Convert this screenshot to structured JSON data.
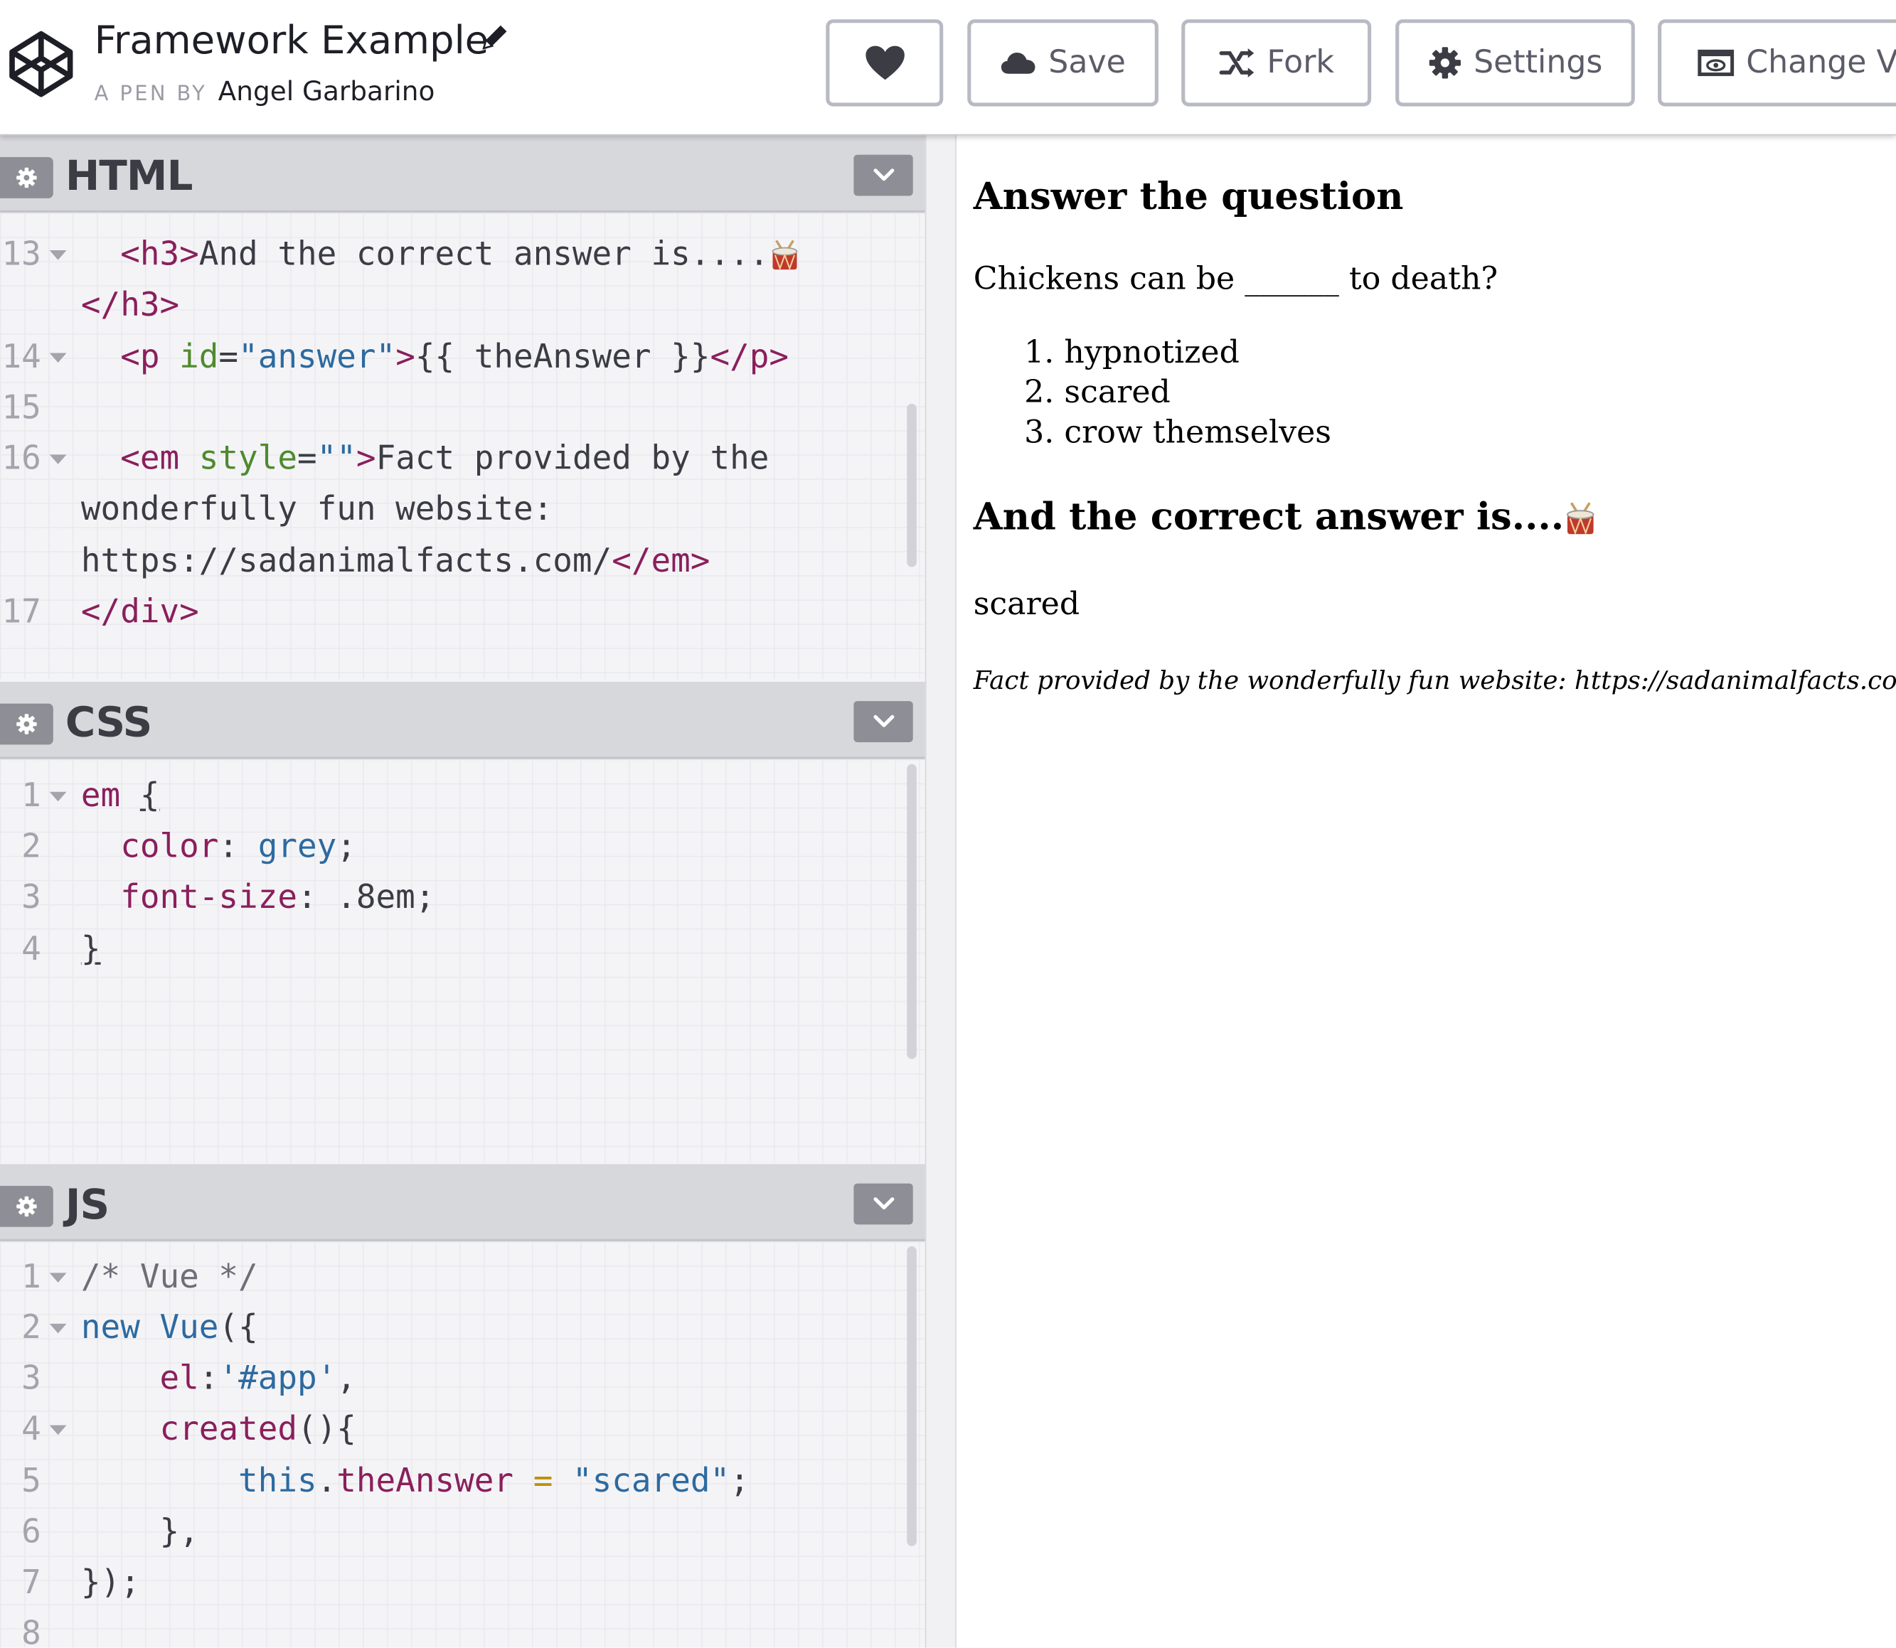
{
  "header": {
    "pen_title": "Framework Example",
    "byline_prefix": "A PEN BY",
    "author": "Angel Garbarino",
    "buttons": {
      "heart_icon": "heart-icon",
      "save": "Save",
      "fork": "Fork",
      "settings": "Settings",
      "change_view": "Change View"
    }
  },
  "editors": {
    "html": {
      "title": "HTML",
      "lines": [
        {
          "num": "13",
          "fold": true,
          "indent": "  ",
          "tag_open": "<h3>",
          "text": "And the correct answer is....",
          "wrap": "</h3>"
        },
        {
          "num": "14",
          "fold": true,
          "indent": "  ",
          "tag_open": "<p ",
          "attr_name": "id",
          "eq": "=",
          "attr_val": "\"answer\"",
          "tag_close": ">",
          "text": "{{ theAnswer }}",
          "tag_end": "</p>"
        },
        {
          "num": "15"
        },
        {
          "num": "16",
          "fold": true,
          "indent": "  ",
          "tag_open": "<em ",
          "attr_name": "style",
          "eq": "=",
          "attr_val": "\"\"",
          "tag_close": ">",
          "text": "Fact provided by the",
          "wrap1": "wonderfully fun website:",
          "wrap2_text": "https://sadanimalfacts.com/",
          "wrap2_tag": "</em>"
        },
        {
          "num": "17",
          "tag_end": "</div>"
        }
      ]
    },
    "css": {
      "title": "CSS",
      "lines": [
        {
          "num": "1",
          "selector": "em",
          "brace": "{"
        },
        {
          "num": "2",
          "prop": "color",
          "value": "grey"
        },
        {
          "num": "3",
          "prop": "font-size",
          "value": ".8em"
        },
        {
          "num": "4",
          "brace": "}"
        }
      ]
    },
    "js": {
      "title": "JS",
      "lines": [
        {
          "num": "1",
          "text": "/* Vue */"
        },
        {
          "num": "2",
          "kw": "new",
          "name": "Vue",
          "rest": "({"
        },
        {
          "num": "3",
          "prop": "el",
          "sep": ":",
          "str": "'#app'",
          "rest": ","
        },
        {
          "num": "4",
          "prop": "created",
          "rest": "(){"
        },
        {
          "num": "5",
          "kw": "this",
          "dot": ".",
          "prop": "theAnswer",
          "op": "=",
          "str": "\"scared\"",
          "rest": ";"
        },
        {
          "num": "6",
          "rest": "},"
        },
        {
          "num": "7",
          "rest": "});"
        },
        {
          "num": "8"
        }
      ]
    }
  },
  "preview": {
    "heading1": "Answer the question",
    "question": "Chickens can be ______ to death?",
    "options": [
      "hypnotized",
      "scared",
      "crow themselves"
    ],
    "heading2": "And the correct answer is....",
    "answer": "scared",
    "fact": "Fact provided by the wonderfully fun website: https://sadanimalfacts.com/"
  },
  "colors": {
    "tag": "#8a1f5c",
    "attribute": "#4f8a2f",
    "string": "#2d6aa0",
    "panel_header": "#d7d8dc",
    "button_border": "#b8bac3"
  }
}
